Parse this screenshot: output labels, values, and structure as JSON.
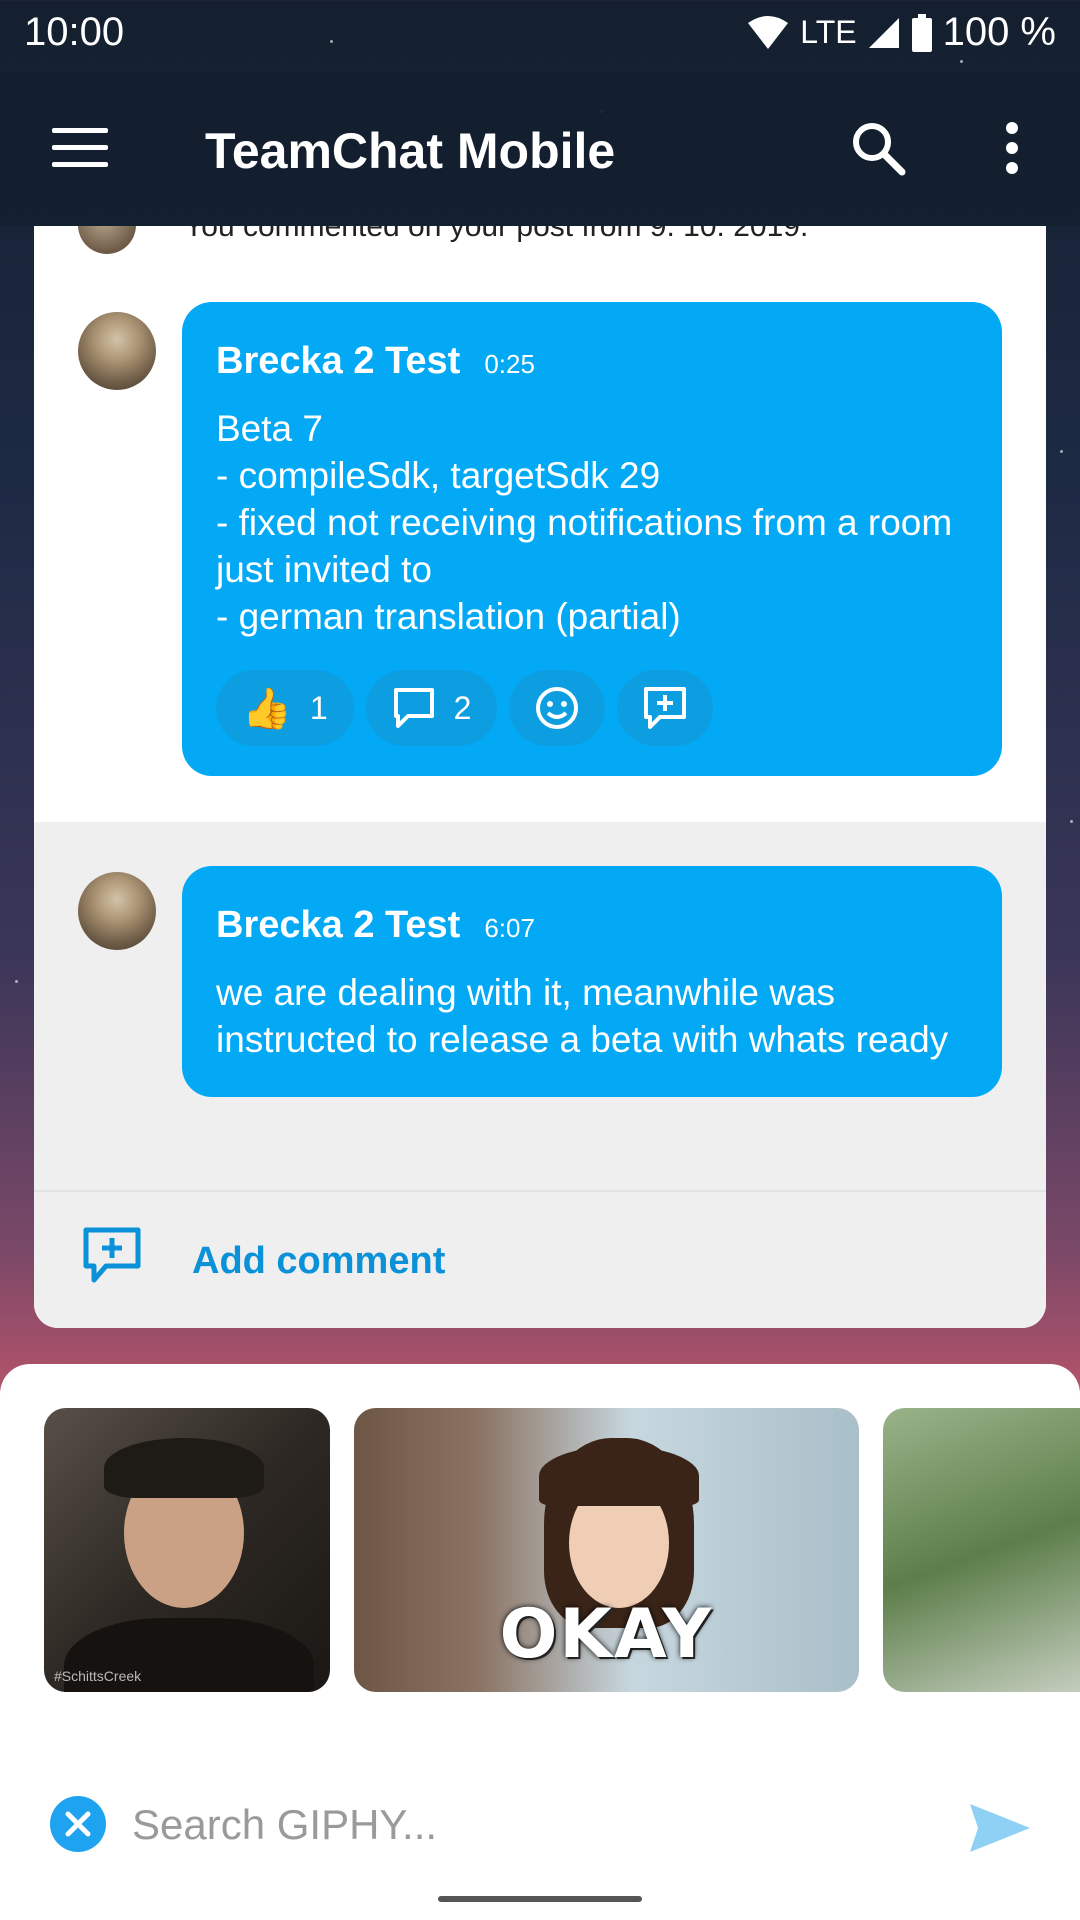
{
  "status_bar": {
    "time": "10:00",
    "network": "LTE",
    "battery": "100 %"
  },
  "app_bar": {
    "title": "TeamChat Mobile",
    "icons": [
      "menu-icon",
      "search-icon",
      "more-vert-icon"
    ]
  },
  "feed": {
    "partial_notice": "You commented on your post from 9. 10. 2019.",
    "post": {
      "author": "Brecka 2 Test",
      "time": "0:25",
      "body": "Beta 7\n- compileSdk, targetSdk 29\n- fixed not receiving notifications from a room just invited to\n- german translation (partial)",
      "reactions": {
        "like_count": "1",
        "comment_count": "2"
      }
    },
    "comment": {
      "author": "Brecka 2 Test",
      "time": "6:07",
      "body": "we are dealing with it, meanwhile was instructed to release a beta with whats ready"
    },
    "add_comment_label": "Add comment"
  },
  "giphy": {
    "gifs": [
      {
        "caption": "",
        "watermark": "#SchittsCreek"
      },
      {
        "caption": "OKAY"
      },
      {
        "caption": ""
      }
    ],
    "search_placeholder": "Search GIPHY..."
  },
  "colors": {
    "accent": "#03a9f4",
    "link": "#0a91d8",
    "appbar": "#14202f"
  }
}
